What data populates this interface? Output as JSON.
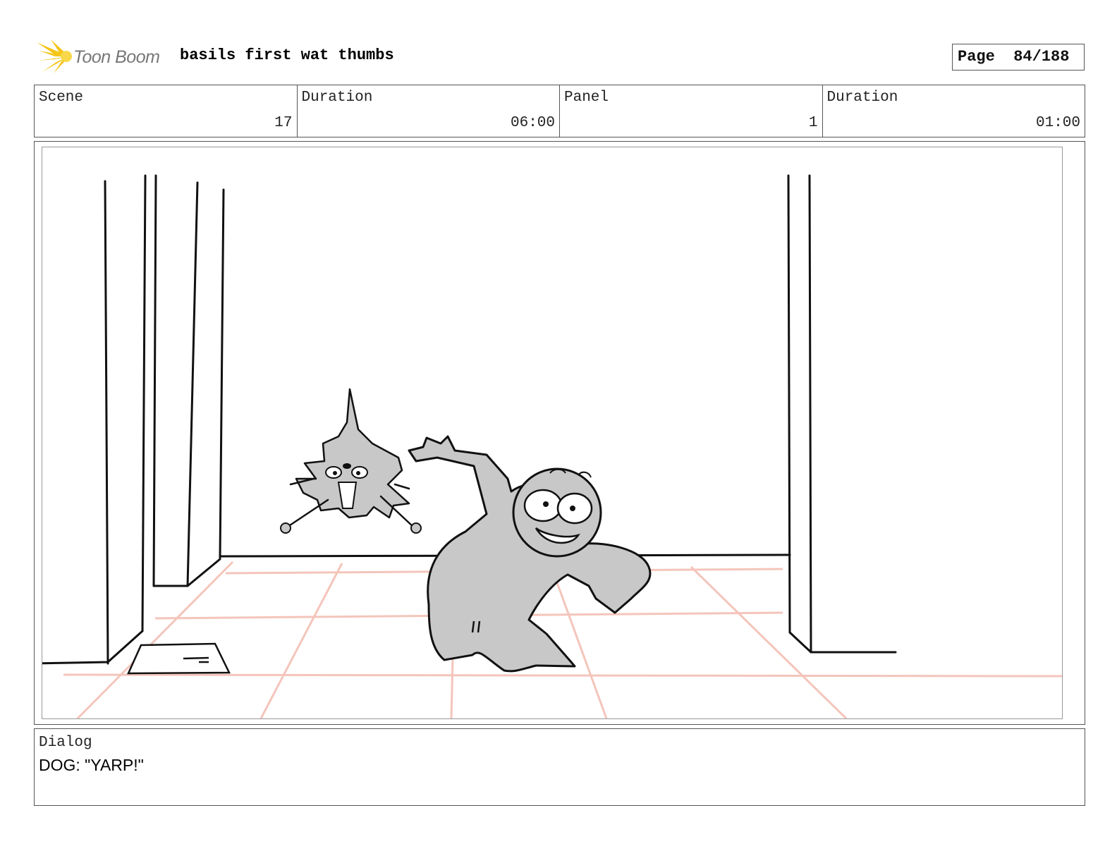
{
  "header": {
    "brand": "Toon Boom",
    "title": "basils first wat thumbs",
    "page_label": "Page",
    "page_value": "84/188"
  },
  "info": {
    "scene_label": "Scene",
    "scene_value": "17",
    "scene_duration_label": "Duration",
    "scene_duration_value": "06:00",
    "panel_label": "Panel",
    "panel_value": "1",
    "panel_duration_label": "Duration",
    "panel_duration_value": "01:00"
  },
  "dialog": {
    "label": "Dialog",
    "text": "DOG: \"YARP!\""
  },
  "colors": {
    "brand_yellow": "#f5c518",
    "floor_grid": "#f4c5bb",
    "character_fill": "#c8c8c8"
  }
}
